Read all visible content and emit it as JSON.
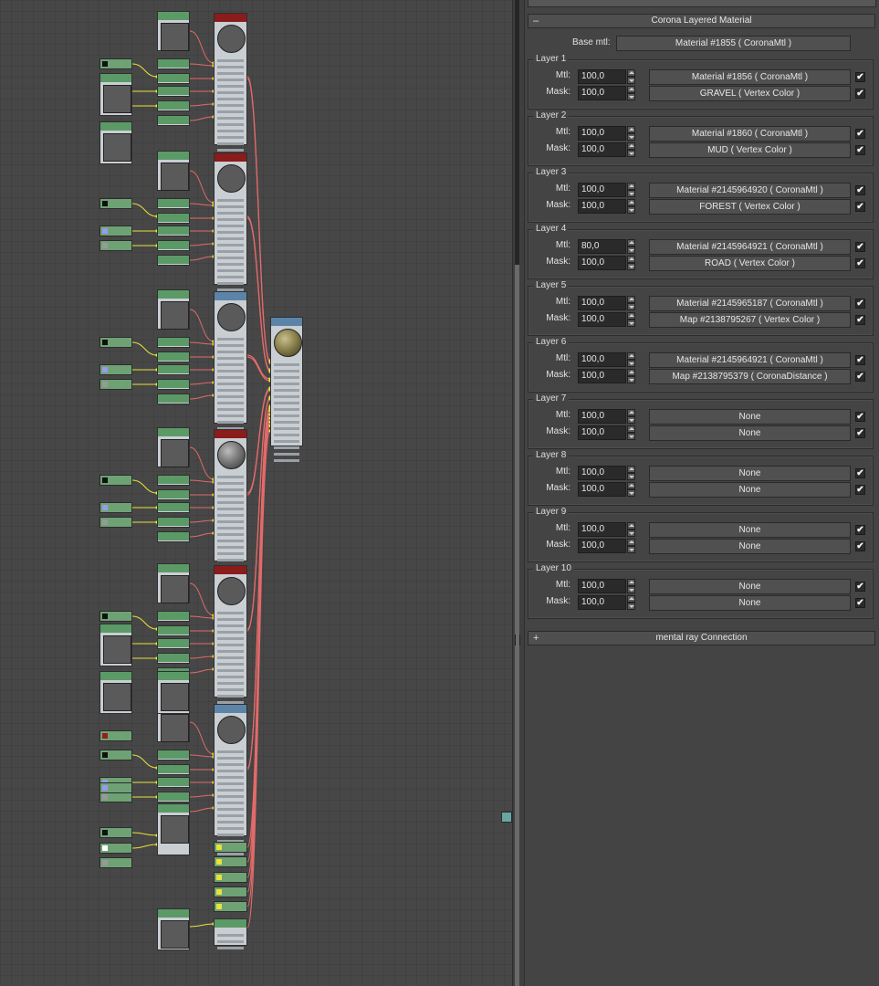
{
  "panel": {
    "rollout_title": "Corona Layered Material",
    "rollout_toggle": "–",
    "base_mtl_label": "Base mtl:",
    "base_mtl_value": "Material #1855  ( CoronaMtl )",
    "mtl_label": "Mtl:",
    "mask_label": "Mask:",
    "checkmark": "✔",
    "spinner_arrow_icons": [
      "arrow-up-icon",
      "arrow-down-icon"
    ],
    "layers": [
      {
        "title": "Layer 1",
        "mtl_amount": "100,0",
        "mtl_value": "Material #1856  ( CoronaMtl )",
        "mask_amount": "100,0",
        "mask_value": "GRAVEL  ( Vertex Color )"
      },
      {
        "title": "Layer 2",
        "mtl_amount": "100,0",
        "mtl_value": "Material #1860  ( CoronaMtl )",
        "mask_amount": "100,0",
        "mask_value": "MUD  ( Vertex Color )"
      },
      {
        "title": "Layer 3",
        "mtl_amount": "100,0",
        "mtl_value": "Material #2145964920  ( CoronaMtl )",
        "mask_amount": "100,0",
        "mask_value": "FOREST  ( Vertex Color )"
      },
      {
        "title": "Layer 4",
        "mtl_amount": "80,0",
        "mtl_value": "Material #2145964921  ( CoronaMtl )",
        "mask_amount": "100,0",
        "mask_value": "ROAD  ( Vertex Color )"
      },
      {
        "title": "Layer 5",
        "mtl_amount": "100,0",
        "mtl_value": "Material #2145965187  ( CoronaMtl )",
        "mask_amount": "100,0",
        "mask_value": "Map #2138795267  ( Vertex Color )"
      },
      {
        "title": "Layer 6",
        "mtl_amount": "100,0",
        "mtl_value": "Material #2145964921  ( CoronaMtl )",
        "mask_amount": "100,0",
        "mask_value": "Map #2138795379  ( CoronaDistance )"
      },
      {
        "title": "Layer 7",
        "mtl_amount": "100,0",
        "mtl_value": "None",
        "mask_amount": "100,0",
        "mask_value": "None"
      },
      {
        "title": "Layer 8",
        "mtl_amount": "100,0",
        "mtl_value": "None",
        "mask_amount": "100,0",
        "mask_value": "None"
      },
      {
        "title": "Layer 9",
        "mtl_amount": "100,0",
        "mtl_value": "None",
        "mask_amount": "100,0",
        "mask_value": "None"
      },
      {
        "title": "Layer 10",
        "mtl_amount": "100,0",
        "mtl_value": "None",
        "mask_amount": "100,0",
        "mask_value": "None"
      }
    ],
    "mental_ray_title": "mental ray Connection",
    "mental_ray_toggle": "+"
  },
  "slate": {
    "wire_color": "#e46a6a",
    "wire_highlight": "#e8e23a"
  }
}
